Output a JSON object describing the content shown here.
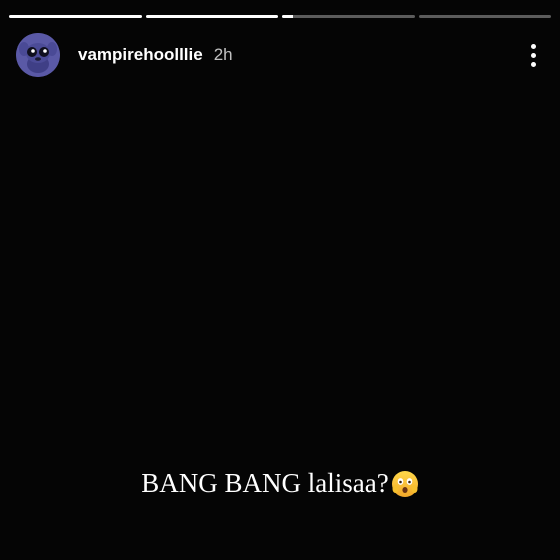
{
  "story": {
    "progress": [
      1,
      1,
      0.08,
      0
    ],
    "username": "vampirehoolllie",
    "time": "2h",
    "caption": "BANG BANG lalisaa?",
    "caption_emoji_icon": "astonished-face-icon",
    "more_icon": "more-vertical-icon",
    "avatar_icon": "cartoon-avatar-icon"
  }
}
